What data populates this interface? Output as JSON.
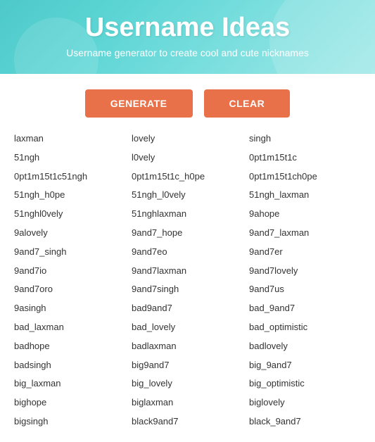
{
  "header": {
    "title": "Username Ideas",
    "subtitle": "Username generator to create cool and cute nicknames"
  },
  "buttons": {
    "generate": "GENERATE",
    "clear": "CLEAR"
  },
  "columns": [
    [
      "laxman",
      "51ngh",
      "0pt1m15t1c51ngh",
      "51ngh_h0pe",
      "51nghl0vely",
      "9alovely",
      "9and7_singh",
      "9and7io",
      "9and7oro",
      "9asingh",
      "bad_laxman",
      "badhope",
      "badsingh",
      "big_laxman",
      "bighope",
      "bigsingh"
    ],
    [
      "lovely",
      "l0vely",
      "0pt1m15t1c_h0pe",
      "51ngh_l0vely",
      "51nghlaxman",
      "9and7_hope",
      "9and7eo",
      "9and7laxman",
      "9and7singh",
      "bad9and7",
      "bad_lovely",
      "badlaxman",
      "big9and7",
      "big_lovely",
      "biglaxman",
      "black9and7"
    ],
    [
      "singh",
      "0pt1m15t1c",
      "0pt1m15t1ch0pe",
      "51ngh_laxman",
      "9ahope",
      "9and7_laxman",
      "9and7er",
      "9and7lovely",
      "9and7us",
      "bad_9and7",
      "bad_optimistic",
      "badlovely",
      "big_9and7",
      "big_optimistic",
      "biglovely",
      "black_9and7"
    ]
  ]
}
